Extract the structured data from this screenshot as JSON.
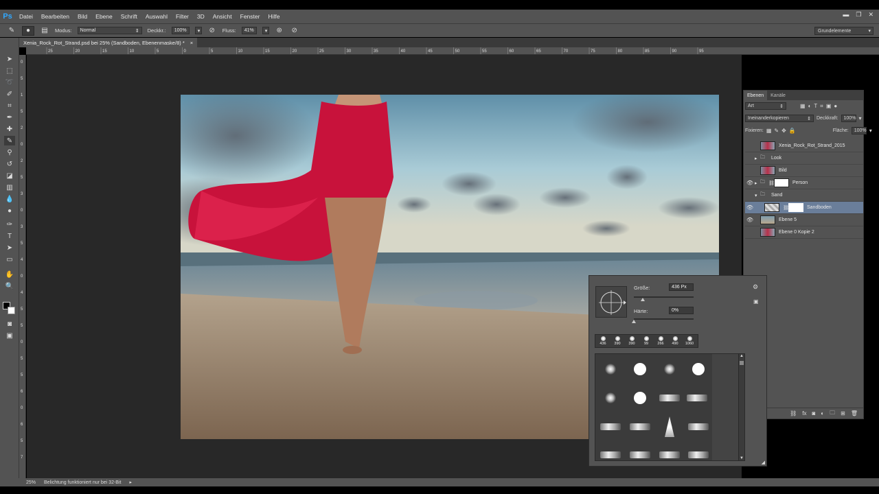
{
  "app": {
    "logo": "Ps"
  },
  "menu": [
    "Datei",
    "Bearbeiten",
    "Bild",
    "Ebene",
    "Schrift",
    "Auswahl",
    "Filter",
    "3D",
    "Ansicht",
    "Fenster",
    "Hilfe"
  ],
  "options": {
    "modus_label": "Modus:",
    "modus_value": "Normal",
    "deckkraft_label": "Deckkr.:",
    "deckkraft_value": "100%",
    "fluss_label": "Fluss:",
    "fluss_value": "41%",
    "workspace": "Grundelemente"
  },
  "document": {
    "tab_title": "Xenia_Rock_Rot_Strand.psd bei 25% (Sandboden, Ebenenmaske/8) *",
    "close": "×"
  },
  "ruler_h": [
    "25",
    "20",
    "15",
    "10",
    "5",
    "0",
    "5",
    "10",
    "15",
    "20",
    "25",
    "30",
    "35",
    "40",
    "45",
    "50",
    "55",
    "60",
    "65",
    "70",
    "75",
    "80",
    "85",
    "90",
    "95"
  ],
  "ruler_v": [
    "0",
    "5",
    "1",
    "5",
    "2",
    "0",
    "2",
    "5",
    "3",
    "0",
    "3",
    "5",
    "4",
    "0",
    "4",
    "5",
    "5",
    "0",
    "5",
    "5",
    "6",
    "0",
    "6",
    "5",
    "7"
  ],
  "layers_panel": {
    "tabs": [
      "Ebenen",
      "Kanäle"
    ],
    "filter_label": "Art",
    "blend_mode": "Ineinanderkopieren",
    "opacity_label": "Deckkraft:",
    "opacity_value": "100%",
    "lock_label": "Fixieren:",
    "fill_label": "Fläche:",
    "fill_value": "100%",
    "layers": [
      {
        "name": "Xenia_Rock_Rot_Strand_2015",
        "visible": false,
        "type": "layer"
      },
      {
        "name": "Look",
        "visible": false,
        "type": "group"
      },
      {
        "name": "Bild",
        "visible": false,
        "type": "layer"
      },
      {
        "name": "Person",
        "visible": true,
        "type": "group"
      },
      {
        "name": "Sand",
        "visible": false,
        "type": "group-open"
      },
      {
        "name": "Sandboden",
        "visible": true,
        "type": "layer-selected"
      },
      {
        "name": "Ebene 5",
        "visible": true,
        "type": "layer"
      },
      {
        "name": "Ebene 0 Kopie 2",
        "visible": false,
        "type": "layer"
      }
    ]
  },
  "brush_picker": {
    "size_label": "Größe:",
    "size_value": "436 Px",
    "hardness_label": "Härte:",
    "hardness_value": "0%",
    "size_fraction": 0.15,
    "hardness_fraction": 0.0,
    "recent_sizes": [
      "436",
      "390",
      "390",
      "99",
      "266",
      "490",
      "1060"
    ]
  },
  "status": {
    "zoom": "25%",
    "message": "Belichtung funktioniert nur bei 32-Bit"
  }
}
